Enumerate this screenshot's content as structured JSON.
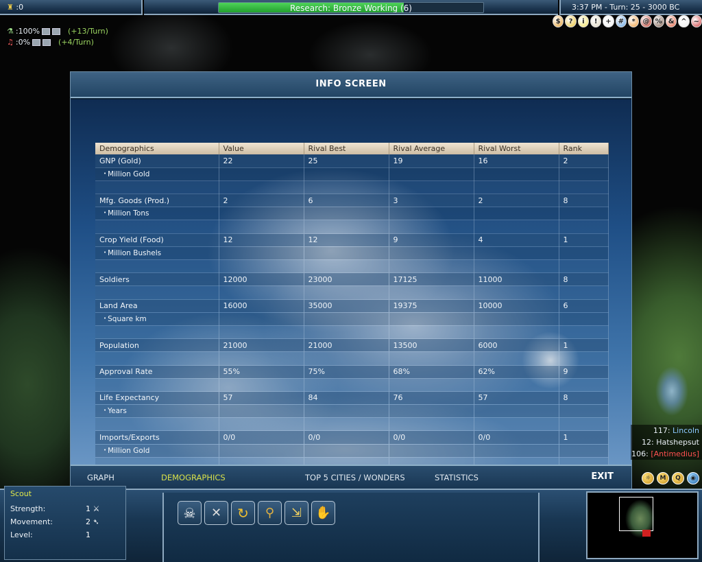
{
  "top": {
    "gold": "0",
    "research": {
      "label": "Research: Bronze Working (6)",
      "progress": 0.7
    },
    "clock": "3:37 PM - Turn: 25 - 3000 BC"
  },
  "rates": [
    {
      "icon": "science-flask-icon",
      "pct": ":100%",
      "turn": "(+13/Turn)"
    },
    {
      "icon": "culture-icon",
      "pct": ":0%",
      "turn": "(+4/Turn)"
    }
  ],
  "advisors": [
    "$",
    "?",
    "i",
    "!",
    "+",
    "#",
    "*",
    "@",
    "%",
    "&",
    "^",
    "~"
  ],
  "panel": {
    "title": "INFO SCREEN",
    "columns": [
      "Demographics",
      "Value",
      "Rival Best",
      "Rival Average",
      "Rival Worst",
      "Rank"
    ],
    "rows": [
      {
        "type": "main",
        "cells": [
          "GNP (Gold)",
          "22",
          "25",
          "19",
          "16",
          "2"
        ]
      },
      {
        "type": "sub",
        "label": "Million Gold"
      },
      {
        "type": "blank"
      },
      {
        "type": "main",
        "cells": [
          "Mfg. Goods (Prod.)",
          "2",
          "6",
          "3",
          "2",
          "8"
        ]
      },
      {
        "type": "sub",
        "label": "Million Tons"
      },
      {
        "type": "blank"
      },
      {
        "type": "main",
        "cells": [
          "Crop Yield (Food)",
          "12",
          "12",
          "9",
          "4",
          "1"
        ]
      },
      {
        "type": "sub",
        "label": "Million Bushels"
      },
      {
        "type": "blank"
      },
      {
        "type": "main",
        "cells": [
          "Soldiers",
          "12000",
          "23000",
          "17125",
          "11000",
          "8"
        ]
      },
      {
        "type": "blank"
      },
      {
        "type": "main",
        "cells": [
          "Land Area",
          "16000",
          "35000",
          "19375",
          "10000",
          "6"
        ]
      },
      {
        "type": "sub",
        "label": "Square km"
      },
      {
        "type": "blank"
      },
      {
        "type": "main",
        "cells": [
          "Population",
          "21000",
          "21000",
          "13500",
          "6000",
          "1"
        ]
      },
      {
        "type": "blank"
      },
      {
        "type": "main",
        "cells": [
          "Approval Rate",
          "55%",
          "75%",
          "68%",
          "62%",
          "9"
        ]
      },
      {
        "type": "blank"
      },
      {
        "type": "main",
        "cells": [
          "Life Expectancy",
          "57",
          "84",
          "76",
          "57",
          "8"
        ]
      },
      {
        "type": "sub",
        "label": "Years"
      },
      {
        "type": "blank"
      },
      {
        "type": "main",
        "cells": [
          "Imports/Exports",
          "0/0",
          "0/0",
          "0/0",
          "0/0",
          "1"
        ]
      },
      {
        "type": "sub",
        "label": "Million Gold"
      },
      {
        "type": "blank"
      }
    ],
    "tabs": [
      "GRAPH",
      "DEMOGRAPHICS",
      "TOP 5 CITIES / WONDERS",
      "STATISTICS"
    ],
    "active_tab": "DEMOGRAPHICS",
    "exit": "EXIT"
  },
  "leaders": [
    {
      "score": "117:",
      "name": "Lincoln",
      "color": "blue"
    },
    {
      "score": "12:",
      "name": "Hatshepsut",
      "color": "white"
    },
    {
      "score": "106:",
      "name": "[Antimedius]",
      "color": "red"
    }
  ],
  "unit": {
    "name": "Scout",
    "stats": [
      {
        "label": "Strength:",
        "value": "1"
      },
      {
        "label": "Movement:",
        "value": "2"
      },
      {
        "label": "Level:",
        "value": "1"
      }
    ]
  },
  "actions": [
    "skull-icon",
    "cancel-promotion-icon",
    "sentry-icon",
    "explore-icon",
    "automate-icon",
    "handshake-icon"
  ]
}
